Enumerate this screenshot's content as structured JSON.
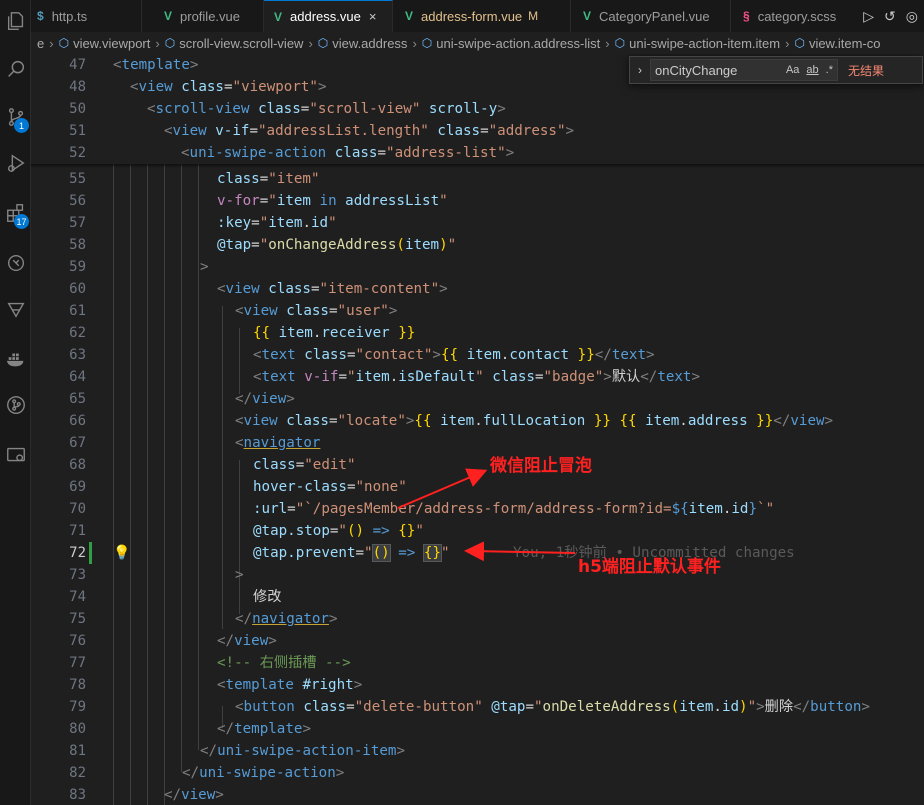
{
  "tabs": [
    {
      "icon": "$",
      "label": "http.ts",
      "icon_color": "#519aba"
    },
    {
      "icon": "V",
      "label": "profile.vue",
      "icon_color": "#41b883"
    },
    {
      "icon": "V",
      "label": "address.vue",
      "icon_color": "#41b883",
      "active": true,
      "close": "×"
    },
    {
      "icon": "V",
      "label": "address-form.vue",
      "icon_color": "#41b883",
      "modified": "M"
    },
    {
      "icon": "V",
      "label": "CategoryPanel.vue",
      "icon_color": "#41b883"
    },
    {
      "icon": "§",
      "label": "category.scss",
      "icon_color": "#f55385"
    }
  ],
  "breadcrumb": [
    "e",
    "view.viewport",
    "scroll-view.scroll-view",
    "view.address",
    "uni-swipe-action.address-list",
    "uni-swipe-action-item.item",
    "view.item-co"
  ],
  "activity_badges": {
    "source_control": "1",
    "extensions": "17"
  },
  "find_widget": {
    "query": "onCityChange",
    "match_case": "Aa",
    "whole_word": "ab",
    "regex": ".*",
    "result": "无结果"
  },
  "code": {
    "l47": {
      "n": "47",
      "t1": "<",
      "tag": "template",
      "t2": ">"
    },
    "l48": {
      "n": "48",
      "t1": "<",
      "tag": "view",
      "attr": "class",
      "eq": "=",
      "val": "\"viewport\"",
      "t2": ">"
    },
    "l50": {
      "n": "50",
      "t1": "<",
      "tag": "scroll-view",
      "attr": "class",
      "eq": "=",
      "val": "\"scroll-view\"",
      "attr2": "scroll-y",
      "t2": ">"
    },
    "l51": {
      "n": "51",
      "t1": "<",
      "tag": "view",
      "attr": "v-if",
      "eq": "=",
      "val": "\"addressList.length\"",
      "attr2": "class",
      "eq2": "=",
      "val2": "\"address\"",
      "t2": ">"
    },
    "l52": {
      "n": "52",
      "t1": "<",
      "tag": "uni-swipe-action",
      "attr": "class",
      "eq": "=",
      "val": "\"address-list\"",
      "t2": ">"
    },
    "l55": {
      "n": "55",
      "attr": "class",
      "eq": "=",
      "val": "\"item\""
    },
    "l56": {
      "n": "56",
      "attr": "v-for",
      "eq": "=",
      "q1": "\"",
      "v1": "item",
      "kw": "in",
      "v2": "addressList",
      "q2": "\""
    },
    "l57": {
      "n": "57",
      "attr": ":key",
      "eq": "=",
      "q1": "\"",
      "v1": "item",
      "dot": ".",
      "v2": "id",
      "q2": "\""
    },
    "l58": {
      "n": "58",
      "attr": "@tap",
      "eq": "=",
      "q1": "\"",
      "fn": "onChangeAddress",
      "p1": "(",
      "v1": "item",
      "p2": ")",
      "q2": "\""
    },
    "l59": {
      "n": "59",
      "t": ">"
    },
    "l60": {
      "n": "60",
      "t1": "<",
      "tag": "view",
      "attr": "class",
      "eq": "=",
      "val": "\"item-content\"",
      "t2": ">"
    },
    "l61": {
      "n": "61",
      "t1": "<",
      "tag": "view",
      "attr": "class",
      "eq": "=",
      "val": "\"user\"",
      "t2": ">"
    },
    "l62": {
      "n": "62",
      "b1": "{{",
      "v1": "item",
      "dot": ".",
      "v2": "receiver",
      "b2": "}}"
    },
    "l63": {
      "n": "63",
      "t1": "<",
      "tag": "text",
      "attr": "class",
      "eq": "=",
      "val": "\"contact\"",
      "t2": ">",
      "b1": "{{",
      "v1": "item",
      "dot": ".",
      "v2": "contact",
      "b2": "}}",
      "t3": "</",
      "tag2": "text",
      "t4": ">"
    },
    "l64": {
      "n": "64",
      "t1": "<",
      "tag": "text",
      "attr": "v-if",
      "eq": "=",
      "q1": "\"",
      "v1": "item",
      "dot": ".",
      "v2": "isDefault",
      "q2": "\"",
      "attr2": "class",
      "eq2": "=",
      "val2": "\"badge\"",
      "t2": ">",
      "txt": "默认",
      "t3": "</",
      "tag2": "text",
      "t4": ">"
    },
    "l65": {
      "n": "65",
      "t1": "</",
      "tag": "view",
      "t2": ">"
    },
    "l66": {
      "n": "66",
      "t1": "<",
      "tag": "view",
      "attr": "class",
      "eq": "=",
      "val": "\"locate\"",
      "t2": ">",
      "b1": "{{",
      "v1": "item",
      "dot": ".",
      "v2": "fullLocation",
      "b2": "}}",
      "b3": "{{",
      "v3": "item",
      "dot2": ".",
      "v4": "address",
      "b4": "}}",
      "t3": "</",
      "tag2": "view",
      "t4": ">"
    },
    "l67": {
      "n": "67",
      "t1": "<",
      "tag": "navigator"
    },
    "l68": {
      "n": "68",
      "attr": "class",
      "eq": "=",
      "val": "\"edit\""
    },
    "l69": {
      "n": "69",
      "attr": "hover-class",
      "eq": "=",
      "val": "\"none\""
    },
    "l70": {
      "n": "70",
      "attr": ":url",
      "eq": "=",
      "q1": "\"",
      "s1": "`/pagesMember/address-form/address-form?id=",
      "d1": "${",
      "v1": "item",
      "dot": ".",
      "v2": "id",
      "d2": "}",
      "s2": "`",
      "q2": "\""
    },
    "l71": {
      "n": "71",
      "attr": "@tap.stop",
      "eq": "=",
      "q1": "\"",
      "p1": "()",
      "ar": "=>",
      "b": "{}",
      "q2": "\""
    },
    "l72": {
      "n": "72",
      "attr": "@tap.prevent",
      "eq": "=",
      "q1": "\"",
      "p1": "()",
      "ar": "=>",
      "b": "{}",
      "q2": "\"",
      "ghost": "You, 1秒钟前 • Uncommitted changes"
    },
    "l73": {
      "n": "73",
      "t": ">"
    },
    "l74": {
      "n": "74",
      "txt": "修改"
    },
    "l75": {
      "n": "75",
      "t1": "</",
      "tag": "navigator",
      "t2": ">"
    },
    "l76": {
      "n": "76",
      "t1": "</",
      "tag": "view",
      "t2": ">"
    },
    "l77": {
      "n": "77",
      "c": "<!-- 右侧插槽 -->"
    },
    "l78": {
      "n": "78",
      "t1": "<",
      "tag": "template",
      "attr": "#right",
      "t2": ">"
    },
    "l79": {
      "n": "79",
      "t1": "<",
      "tag": "button",
      "attr": "class",
      "eq": "=",
      "val": "\"delete-button\"",
      "attr2": "@tap",
      "eq2": "=",
      "q1": "\"",
      "fn": "onDeleteAddress",
      "p1": "(",
      "v1": "item",
      "dot": ".",
      "v2": "id",
      "p2": ")",
      "q2": "\"",
      "t2": ">",
      "txt": "删除",
      "t3": "</",
      "tag2": "button",
      "t4": ">"
    },
    "l80": {
      "n": "80",
      "t1": "</",
      "tag": "template",
      "t2": ">"
    },
    "l81": {
      "n": "81",
      "t1": "</",
      "tag": "uni-swipe-action-item",
      "t2": ">"
    },
    "l82": {
      "n": "82",
      "t1": "</",
      "tag": "uni-swipe-action",
      "t2": ">"
    },
    "l83": {
      "n": "83",
      "t1": "</",
      "tag": "view",
      "t2": ">"
    }
  },
  "annotations": {
    "wechat": "微信阻止冒泡",
    "h5": "h5端阻止默认事件"
  },
  "colors": {
    "annotation": "#ff2020",
    "accent": "#0078d4",
    "tag": "#569cd6",
    "attr": "#9cdcfe",
    "string": "#ce9178",
    "function": "#dcdcaa"
  }
}
